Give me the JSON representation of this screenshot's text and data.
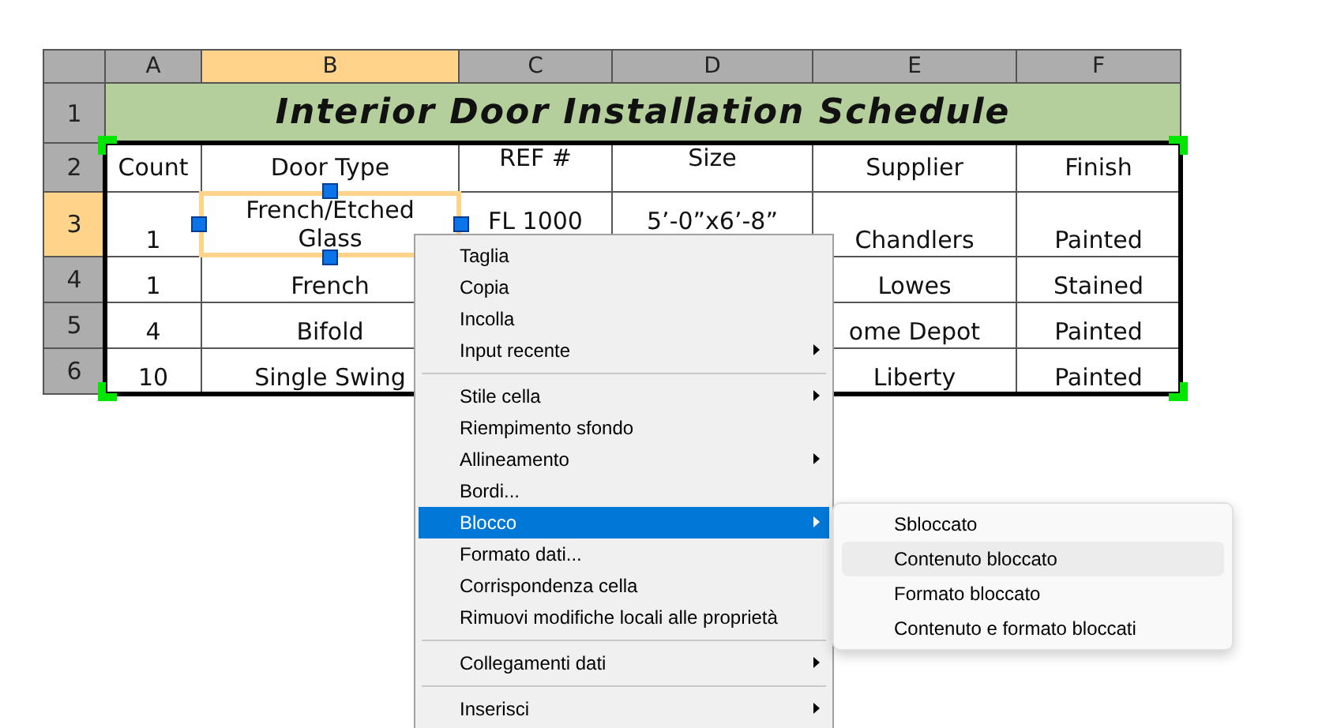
{
  "sheet": {
    "columns": [
      {
        "label": "A",
        "selected": false
      },
      {
        "label": "B",
        "selected": true
      },
      {
        "label": "C",
        "selected": false
      },
      {
        "label": "D",
        "selected": false
      },
      {
        "label": "E",
        "selected": false
      },
      {
        "label": "F",
        "selected": false
      }
    ],
    "title_row": {
      "label": "1",
      "selected": false,
      "title": "Interior Door Installation Schedule"
    },
    "rows": [
      {
        "label": "2",
        "selected": false,
        "cells": [
          {
            "text": "Count",
            "selected": false
          },
          {
            "text": "Door Type",
            "selected": false
          },
          {
            "text": "REF #",
            "selected": false
          },
          {
            "text": "Size",
            "selected": false
          },
          {
            "text": "Supplier",
            "selected": false
          },
          {
            "text": "Finish",
            "selected": false
          }
        ]
      },
      {
        "label": "3",
        "selected": true,
        "cells": [
          {
            "text": "1",
            "selected": false
          },
          {
            "text": "French/Etched Glass",
            "selected": true
          },
          {
            "text": "FL 1000",
            "selected": false
          },
          {
            "text": "5’-0”x6’-8”",
            "selected": false
          },
          {
            "text": "Chandlers",
            "selected": false
          },
          {
            "text": "Painted",
            "selected": false
          }
        ]
      },
      {
        "label": "4",
        "selected": false,
        "cells": [
          {
            "text": "1",
            "selected": false
          },
          {
            "text": "French",
            "selected": false
          },
          null,
          null,
          {
            "text": "Lowes",
            "selected": false
          },
          {
            "text": "Stained",
            "selected": false
          }
        ]
      },
      {
        "label": "5",
        "selected": false,
        "cells": [
          {
            "text": "4",
            "selected": false
          },
          {
            "text": "Bifold",
            "selected": false
          },
          null,
          null,
          {
            "text": "ome Depot",
            "selected": false
          },
          {
            "text": "Painted",
            "selected": false
          }
        ]
      },
      {
        "label": "6",
        "selected": false,
        "cells": [
          {
            "text": "10",
            "selected": false
          },
          {
            "text": "Single Swing",
            "selected": false
          },
          null,
          null,
          {
            "text": "Liberty",
            "selected": false
          },
          {
            "text": "Painted",
            "selected": false
          }
        ]
      }
    ]
  },
  "context_menu": {
    "items": [
      {
        "kind": "item",
        "label": "Taglia",
        "submenu": false,
        "selected": false
      },
      {
        "kind": "item",
        "label": "Copia",
        "submenu": false,
        "selected": false
      },
      {
        "kind": "item",
        "label": "Incolla",
        "submenu": false,
        "selected": false
      },
      {
        "kind": "item",
        "label": "Input recente",
        "submenu": true,
        "selected": false
      },
      {
        "kind": "separator"
      },
      {
        "kind": "item",
        "label": "Stile cella",
        "submenu": true,
        "selected": false
      },
      {
        "kind": "item",
        "label": "Riempimento sfondo",
        "submenu": false,
        "selected": false
      },
      {
        "kind": "item",
        "label": "Allineamento",
        "submenu": true,
        "selected": false
      },
      {
        "kind": "item",
        "label": "Bordi...",
        "submenu": false,
        "selected": false
      },
      {
        "kind": "item",
        "label": "Blocco",
        "submenu": true,
        "selected": true
      },
      {
        "kind": "item",
        "label": "Formato dati...",
        "submenu": false,
        "selected": false
      },
      {
        "kind": "item",
        "label": "Corrispondenza cella",
        "submenu": false,
        "selected": false
      },
      {
        "kind": "item",
        "label": "Rimuovi modifiche locali alle proprietà",
        "submenu": false,
        "selected": false
      },
      {
        "kind": "separator"
      },
      {
        "kind": "item",
        "label": "Collegamenti dati",
        "submenu": true,
        "selected": false
      },
      {
        "kind": "separator"
      },
      {
        "kind": "item",
        "label": "Inserisci",
        "submenu": true,
        "selected": false
      }
    ]
  },
  "submenu": {
    "items": [
      {
        "label": "Sbloccato",
        "selected": false
      },
      {
        "label": "Contenuto bloccato",
        "selected": true
      },
      {
        "label": "Formato bloccato",
        "selected": false
      },
      {
        "label": "Contenuto e formato bloccati",
        "selected": false
      }
    ]
  }
}
